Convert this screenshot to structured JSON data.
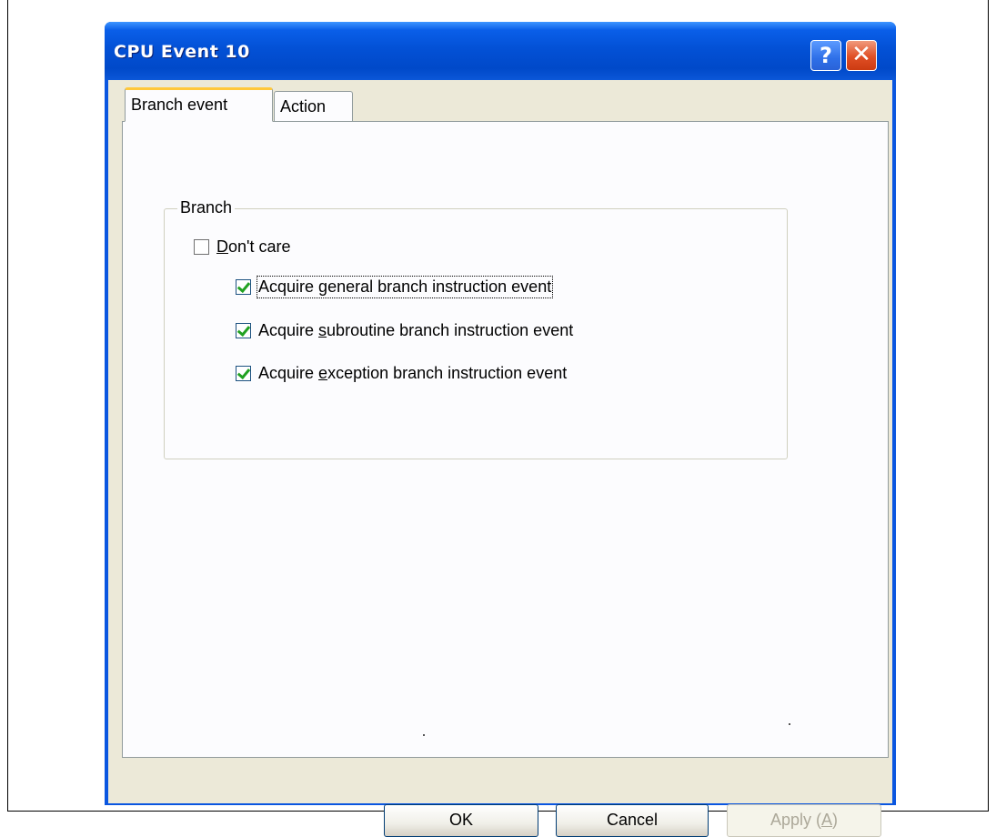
{
  "window": {
    "title": "CPU Event 10",
    "help_label": "?",
    "close_label": "✕"
  },
  "tabs": [
    {
      "label": "Branch event",
      "selected": true
    },
    {
      "label": "Action",
      "selected": false
    }
  ],
  "branch_group": {
    "legend": "Branch",
    "dont_care": {
      "pre": "",
      "accel": "D",
      "post": "on't care",
      "checked": false
    },
    "options": [
      {
        "pre": "Acquire ",
        "accel": "g",
        "post": "eneral branch instruction event",
        "checked": true
      },
      {
        "pre": "Acquire ",
        "accel": "s",
        "post": "ubroutine branch instruction event",
        "checked": true
      },
      {
        "pre": "Acquire ",
        "accel": "e",
        "post": "xception branch instruction event",
        "checked": true
      }
    ]
  },
  "buttons": {
    "ok": "OK",
    "cancel": "Cancel",
    "apply_pre": "Apply (",
    "apply_accel": "A",
    "apply_post": ")"
  },
  "colors": {
    "title_bar": "#0351d6",
    "dialog_face": "#ece9d8",
    "check_mark": "#21a121",
    "tab_highlight": "#ffc83c"
  }
}
